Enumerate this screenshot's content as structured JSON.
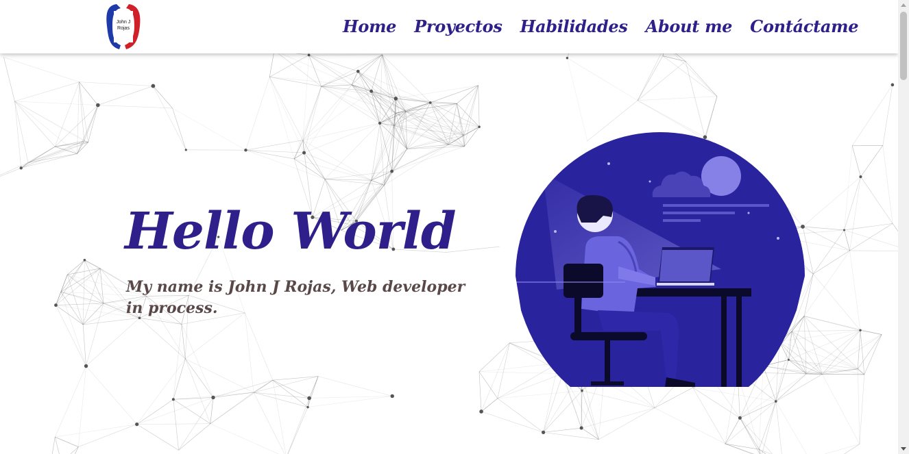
{
  "logo": {
    "text_line1": "John J",
    "text_line2": "Rojas"
  },
  "nav": {
    "items": [
      {
        "label": "Home"
      },
      {
        "label": "Proyectos"
      },
      {
        "label": "Habilidades"
      },
      {
        "label": "About me"
      },
      {
        "label": "Contáctame"
      }
    ]
  },
  "hero": {
    "title": "Hello World",
    "subtitle": "My name is John J Rojas, Web developer in process."
  },
  "colors": {
    "brand": "#2e1f8a",
    "subtitle": "#5a4848",
    "illustration_bg": "#2a239e",
    "logo_red": "#d0202a",
    "logo_blue": "#1e3aa8"
  },
  "icons": [
    "logo-icon",
    "developer-illustration",
    "network-background"
  ]
}
